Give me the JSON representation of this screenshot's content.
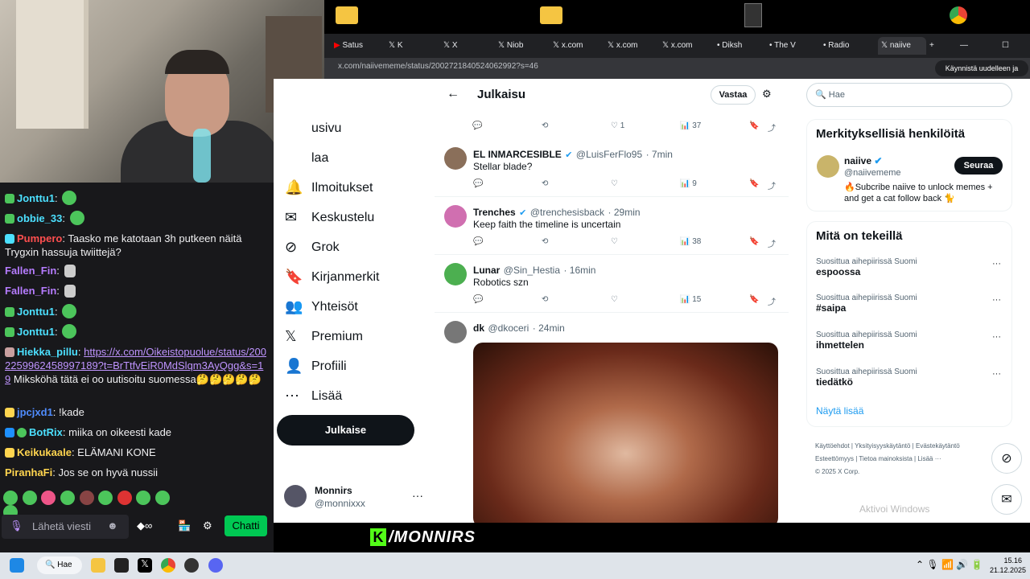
{
  "browser": {
    "tabs": [
      "Satus",
      "K",
      "X",
      "Niob",
      "x.com",
      "x.com",
      "x.com",
      "Diksh",
      "The V",
      "Radio",
      "naiive"
    ],
    "url": "x.com/naiivememe/status/2002721840524062992?s=46",
    "restart_label": "Käynnistä uudelleen ja päivitä"
  },
  "x": {
    "header_title": "Julkaisu",
    "reply_button": "Vastaa",
    "search_placeholder": "Hae",
    "nav": [
      "usivu",
      "laa",
      "Ilmoitukset",
      "Keskustelu",
      "Grok",
      "Kirjanmerkit",
      "Yhteisöt",
      "Premium",
      "Profiili",
      "Lisää"
    ],
    "post_button": "Julkaise",
    "account": {
      "name": "Monnirs",
      "handle": "@monnixxx"
    },
    "top_actions": {
      "likes": "1",
      "views": "37"
    },
    "posts": [
      {
        "name": "EL INMARCESIBLE",
        "handle": "@LuisFerFlo95",
        "time": "· 7min",
        "text": "Stellar blade?",
        "views": "9"
      },
      {
        "name": "Trenches",
        "handle": "@trenchesisback",
        "time": "· 29min",
        "text": "Keep faith the timeline is uncertain",
        "views": "38"
      },
      {
        "name": "Lunar",
        "handle": "@Sin_Hestia",
        "time": "· 16min",
        "text": "Robotics szn",
        "views": "15"
      },
      {
        "name": "dk",
        "handle": "@dkoceri",
        "time": "· 24min",
        "text": "",
        "views": ""
      }
    ],
    "who_to_follow": {
      "title": "Merkityksellisiä henkilöitä",
      "name": "naiive",
      "handle": "@naiivememe",
      "bio": "🔥Subcribe naiive to unlock memes + and get a cat follow back 🐈",
      "follow": "Seuraa"
    },
    "trends": {
      "title": "Mitä on tekeillä",
      "items": [
        {
          "context": "Suosittua aihepiirissä Suomi",
          "name": "espoossa"
        },
        {
          "context": "Suosittua aihepiirissä Suomi",
          "name": "#saipa"
        },
        {
          "context": "Suosittua aihepiirissä Suomi",
          "name": "ihmettelen"
        },
        {
          "context": "Suosittua aihepiirissä Suomi",
          "name": "tiedätkö"
        }
      ],
      "show_more": "Näytä lisää"
    },
    "footer": [
      "Käyttöehdot",
      "Yksityisyyskäytäntö",
      "Evästekäytäntö",
      "Esteettömyys",
      "Tietoa mainoksista",
      "Lisää ···",
      "© 2025 X Corp."
    ],
    "activate_windows": "Aktivoi Windows"
  },
  "chat": {
    "lines": [
      {
        "user": "Jonttu1",
        "color": "#4ce0ff",
        "text": ""
      },
      {
        "user": "obbie_33",
        "color": "#4ce0ff",
        "text": ""
      },
      {
        "user": "Pumpero",
        "color": "#ff4f4f",
        "text": "Taasko me katotaan 3h putkeen näitä Trygxin hassuja twiittejä?"
      },
      {
        "user": "Fallen_Fin",
        "color": "#b67cff",
        "text": ""
      },
      {
        "user": "Fallen_Fin",
        "color": "#b67cff",
        "text": ""
      },
      {
        "user": "Jonttu1",
        "color": "#4ce0ff",
        "text": ""
      },
      {
        "user": "Jonttu1",
        "color": "#4ce0ff",
        "text": ""
      },
      {
        "user": "Hiekka_pillu",
        "color": "#4ce0ff",
        "link": "https://x.com/Oikeistopuolue/status/2002259962458997189?t=BrTtfvEiR0MdSlqm3AyQgg&s=19",
        "text": "Miksköhä tätä ei oo uutisoitu suomessa🤔🤔🤔🤔🤔"
      },
      {
        "user": "jpcjxd1",
        "color": "#4f8cff",
        "text": "!kade"
      },
      {
        "user": "BotRix",
        "color": "#4ce0ff",
        "text": "miika on oikeesti kade"
      },
      {
        "user": "Keikukaale",
        "color": "#ffd54f",
        "text": "ELÄMANI KONE"
      },
      {
        "user": "PiranhaFi",
        "color": "#ffd54f",
        "text": "Jos se on hyvä nussii"
      }
    ],
    "input_placeholder": "Lähetä viesti",
    "send_label": "Chatti"
  },
  "banner": {
    "text": "/MONNIRS"
  },
  "taskbar": {
    "search": "Hae",
    "time": "15.16",
    "date": "21.12.2025"
  }
}
